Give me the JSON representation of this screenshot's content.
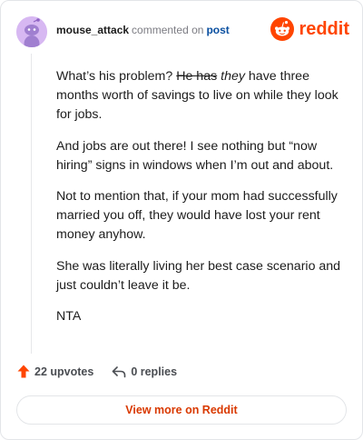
{
  "header": {
    "username": "mouse_attack",
    "action_text": "commented on",
    "post_link": "post",
    "brand": "reddit"
  },
  "comment": {
    "p1_a": "What’s his problem?",
    "p1_strike": "He has",
    "p1_em": "they",
    "p1_b": "have three months worth of savings to live on while they look for jobs.",
    "p2": "And jobs are out there! I see nothing but “now hiring” signs in windows when I’m out and about.",
    "p3": "Not to mention that, if your mom had successfully married you off, they would have lost your rent money anyhow.",
    "p4": "She was literally living her best case scenario and just couldn’t leave it be.",
    "p5": "NTA"
  },
  "actions": {
    "upvotes": "22 upvotes",
    "replies": "0 replies"
  },
  "view_button": "View more on Reddit",
  "colors": {
    "brand": "#ff4500",
    "link": "#0a4fa0",
    "button_text": "#d93900",
    "avatar_bg": "#d7b8f2"
  },
  "icons": [
    "snoo-avatar-icon",
    "reddit-logo-icon",
    "upvote-arrow-icon",
    "reply-arrow-icon"
  ]
}
